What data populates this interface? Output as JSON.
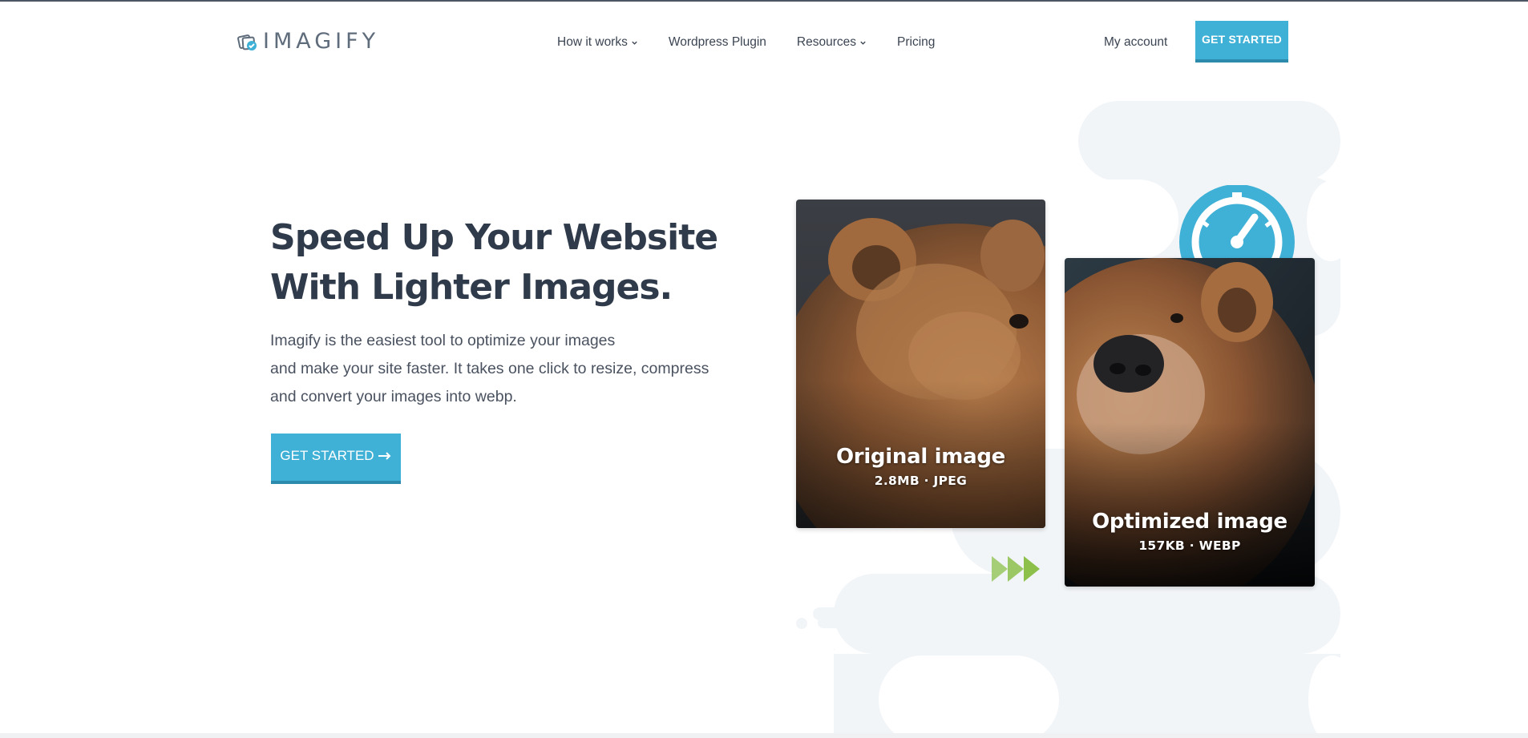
{
  "brand": {
    "logo_text": "IMAGIFY",
    "accent_color": "#40b1d6",
    "accent_dark": "#2c8bad",
    "heading_color": "#2f3a4a",
    "text_color": "#4a5260",
    "blob_color": "#f2f5f8",
    "arrow_color": "#8cc04b"
  },
  "nav": {
    "items": [
      {
        "label": "How it works",
        "has_dropdown": true,
        "icon": "chevron-down-icon"
      },
      {
        "label": "Wordpress Plugin",
        "has_dropdown": false
      },
      {
        "label": "Resources",
        "has_dropdown": true,
        "icon": "chevron-down-icon"
      },
      {
        "label": "Pricing",
        "has_dropdown": false
      }
    ],
    "account_label": "My account",
    "cta_label": "GET STARTED"
  },
  "hero": {
    "title_line1": "Speed Up Your Website",
    "title_line2": "With Lighter Images.",
    "desc_line1": "Imagify is the easiest tool to optimize your images",
    "desc_line2": "and make your site faster. It takes one click to resize, compress",
    "desc_line3": "and convert your images into webp.",
    "cta_label": "GET STARTED",
    "cta_icon": "arrow-right-icon"
  },
  "cards": {
    "original": {
      "title": "Original image",
      "meta": "2.8MB · JPEG"
    },
    "optimized": {
      "title": "Optimized image",
      "meta": "157KB · WEBP"
    }
  },
  "icons": {
    "gauge": "speedometer-icon",
    "arrows": "fast-forward-arrows-icon"
  }
}
